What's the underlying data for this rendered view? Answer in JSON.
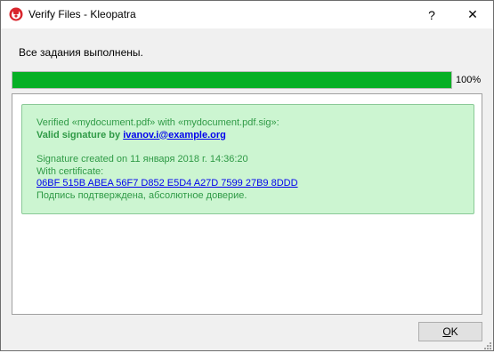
{
  "window": {
    "title": "Verify Files - Kleopatra",
    "help_glyph": "?",
    "close_glyph": "✕"
  },
  "status": {
    "text": "Все задания выполнены.",
    "progress_fraction": 1.0,
    "progress_label": "100%"
  },
  "result": {
    "verified_line": "Verified «mydocument.pdf» with «mydocument.pdf.sig»:",
    "valid_prefix": "Valid signature by ",
    "signer_email": "ivanov.i@example.org",
    "created_line": "Signature created on 11 января 2018 г. 14:36:20",
    "with_certificate": "With certificate:",
    "fingerprint": "06BF 515B ABEA 56F7 D852 E5D4 A27D 7599 27B9 8DDD",
    "trust_line": "Подпись подтверждена, абсолютное доверие."
  },
  "buttons": {
    "ok_first": "O",
    "ok_rest": "K"
  },
  "colors": {
    "progress_fill": "#06b025",
    "result_background": "#ccf5d1",
    "result_border": "#8ac997",
    "result_text": "#2f9a46",
    "link": "#0000ee"
  },
  "icons": {
    "app": "kleopatra-icon",
    "help": "help-icon",
    "close": "close-icon",
    "resize": "resize-grip-icon"
  }
}
